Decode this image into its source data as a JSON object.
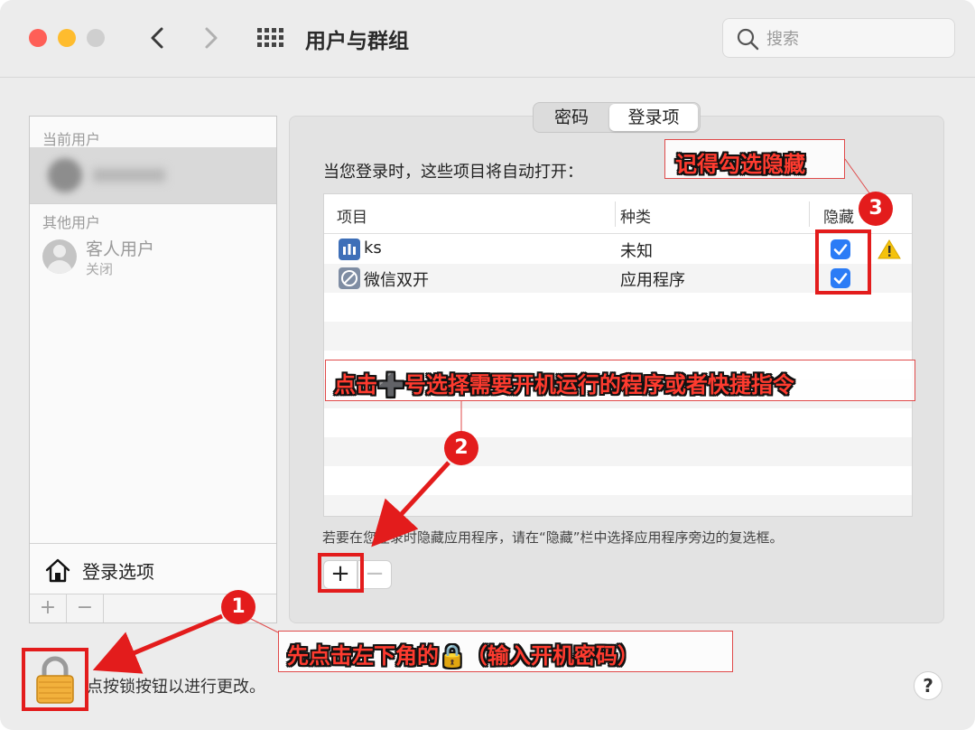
{
  "window": {
    "title": "用户与群组",
    "search_placeholder": "搜索"
  },
  "sidebar": {
    "current_users_label": "当前用户",
    "other_users_label": "其他用户",
    "guest": {
      "name": "客人用户",
      "status": "关闭"
    },
    "login_options_label": "登录选项",
    "add_label": "+",
    "remove_label": "−"
  },
  "tabs": [
    {
      "label": "密码",
      "selected": false
    },
    {
      "label": "登录项",
      "selected": true
    }
  ],
  "main": {
    "intro": "当您登录时，这些项目将自动打开：",
    "columns": {
      "item": "项目",
      "kind": "种类",
      "hide": "隐藏"
    },
    "rows": [
      {
        "name": "ks",
        "kind": "未知",
        "hidden": true,
        "warning": true,
        "icon": "shortcut-app-icon"
      },
      {
        "name": "微信双开",
        "kind": "应用程序",
        "hidden": true,
        "warning": false,
        "icon": "wechat-dual-app-icon"
      }
    ],
    "hint": "若要在您登录时隐藏应用程序，请在“隐藏”栏中选择应用程序旁边的复选框。",
    "add_label": "+",
    "remove_label": "−"
  },
  "lock": {
    "text": "点按锁按钮以进行更改。"
  },
  "help_label": "?",
  "annotations": {
    "step1": {
      "number": "1",
      "text": "先点击左下角的🔒（输入开机密码）"
    },
    "step2": {
      "number": "2",
      "text": "点击➕号选择需要开机运行的程序或者快捷指令"
    },
    "step3": {
      "number": "3",
      "text": "记得勾选隐藏"
    }
  },
  "colors": {
    "annotation_red": "#e31c1c",
    "checkbox_blue": "#2b7cf6",
    "warning_yellow": "#f4c20d"
  }
}
